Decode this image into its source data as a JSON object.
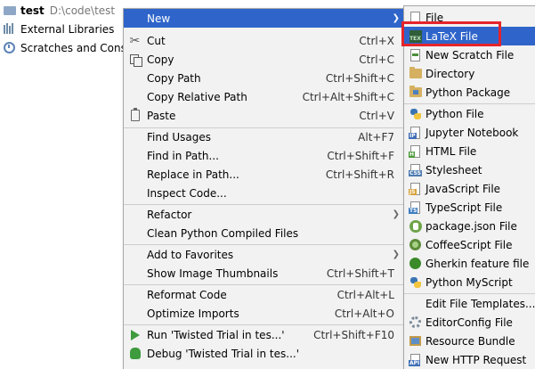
{
  "tree": {
    "project_name": "test",
    "project_path": "D:\\code\\test",
    "external_libraries": "External Libraries",
    "scratches": "Scratches and Conso"
  },
  "main_menu": {
    "items": [
      {
        "label": "New",
        "shortcut": "",
        "submenu": true
      },
      {
        "label": "Cut",
        "shortcut": "Ctrl+X",
        "submenu": false
      },
      {
        "label": "Copy",
        "shortcut": "Ctrl+C",
        "submenu": false
      },
      {
        "label": "Copy Path",
        "shortcut": "Ctrl+Shift+C",
        "submenu": false
      },
      {
        "label": "Copy Relative Path",
        "shortcut": "Ctrl+Alt+Shift+C",
        "submenu": false
      },
      {
        "label": "Paste",
        "shortcut": "Ctrl+V",
        "submenu": false
      },
      {
        "label": "Find Usages",
        "shortcut": "Alt+F7",
        "submenu": false
      },
      {
        "label": "Find in Path...",
        "shortcut": "Ctrl+Shift+F",
        "submenu": false
      },
      {
        "label": "Replace in Path...",
        "shortcut": "Ctrl+Shift+R",
        "submenu": false
      },
      {
        "label": "Inspect Code...",
        "shortcut": "",
        "submenu": false
      },
      {
        "label": "Refactor",
        "shortcut": "",
        "submenu": true
      },
      {
        "label": "Clean Python Compiled Files",
        "shortcut": "",
        "submenu": false
      },
      {
        "label": "Add to Favorites",
        "shortcut": "",
        "submenu": true
      },
      {
        "label": "Show Image Thumbnails",
        "shortcut": "Ctrl+Shift+T",
        "submenu": false
      },
      {
        "label": "Reformat Code",
        "shortcut": "Ctrl+Alt+L",
        "submenu": false
      },
      {
        "label": "Optimize Imports",
        "shortcut": "Ctrl+Alt+O",
        "submenu": false
      },
      {
        "label": "Run 'Twisted Trial in tes...'",
        "shortcut": "Ctrl+Shift+F10",
        "submenu": false
      },
      {
        "label": "Debug 'Twisted Trial in tes...'",
        "shortcut": "",
        "submenu": false
      }
    ]
  },
  "new_submenu": {
    "items": [
      {
        "label": "File"
      },
      {
        "label": "LaTeX File"
      },
      {
        "label": "New Scratch File"
      },
      {
        "label": "Directory"
      },
      {
        "label": "Python Package"
      },
      {
        "label": "Python File"
      },
      {
        "label": "Jupyter Notebook"
      },
      {
        "label": "HTML File"
      },
      {
        "label": "Stylesheet"
      },
      {
        "label": "JavaScript File"
      },
      {
        "label": "TypeScript File"
      },
      {
        "label": "package.json File"
      },
      {
        "label": "CoffeeScript File"
      },
      {
        "label": "Gherkin feature file"
      },
      {
        "label": "Python MyScript"
      },
      {
        "label": "Edit File Templates..."
      },
      {
        "label": "EditorConfig File"
      },
      {
        "label": "Resource Bundle"
      },
      {
        "label": "New HTTP Request"
      }
    ],
    "icon_tags": {
      "latex": "TEX",
      "jupyter": "IP",
      "html": "H",
      "css": "CSS",
      "js": "JS",
      "ts": "TS",
      "http": "API"
    }
  },
  "colors": {
    "highlight": "#2f65ca",
    "callout": "#e5242b",
    "menu_bg": "#f2f2f2"
  }
}
